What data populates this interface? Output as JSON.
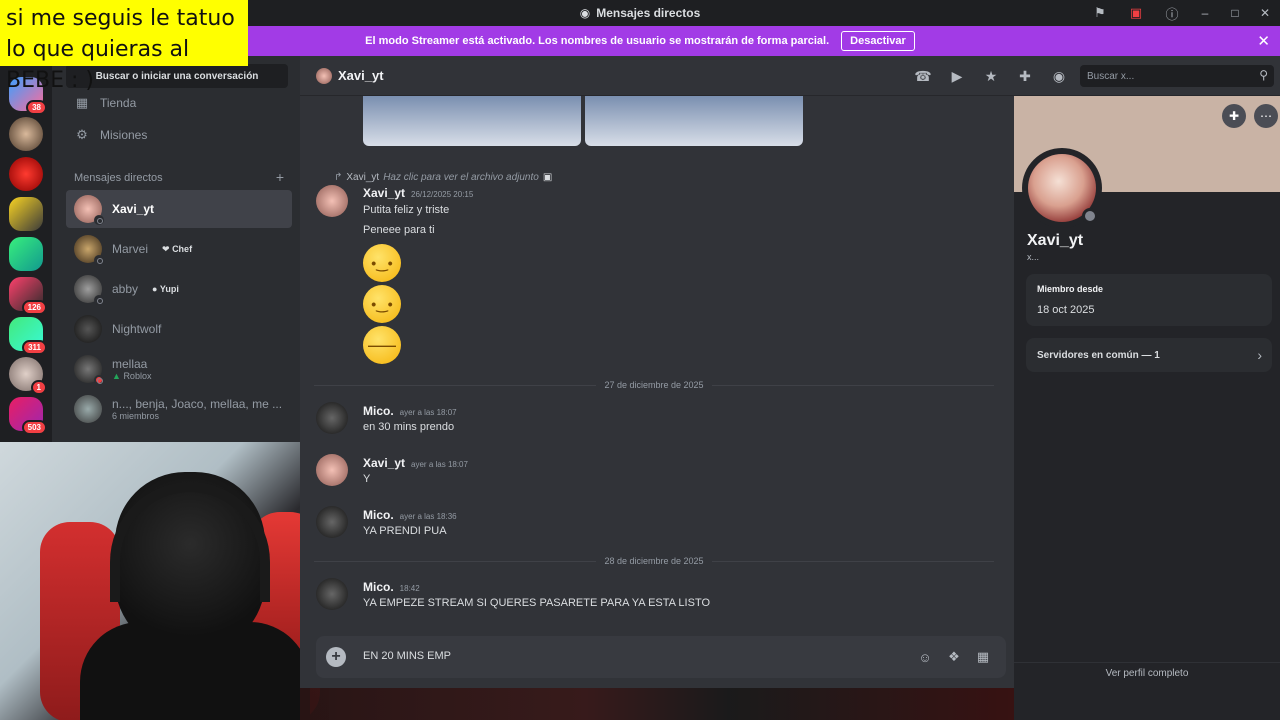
{
  "overlay": {
    "caption": "si me seguis le tatuo lo que quieras al BEBE : )"
  },
  "titlebar": {
    "title": "Mensajes directos",
    "icons": [
      "flag-icon",
      "screen-share-icon",
      "help-icon"
    ]
  },
  "banner": {
    "text": "El modo Streamer está activado. Los nombres de usuario se mostrarán de forma parcial.",
    "button": "Desactivar",
    "color": "#a23be6"
  },
  "servers": [
    {
      "badge": "38"
    },
    {
      "badge": ""
    },
    {
      "badge": ""
    },
    {
      "badge": ""
    },
    {
      "badge": ""
    },
    {
      "badge": "126"
    },
    {
      "badge": "311"
    },
    {
      "badge": "1"
    },
    {
      "badge": "503"
    }
  ],
  "sidebar": {
    "search": "Buscar o iniciar una conversación",
    "nav": [
      {
        "label": "Tienda",
        "icon": "store-icon"
      },
      {
        "label": "Misiones",
        "icon": "quests-icon"
      }
    ],
    "dm_header": "Mensajes directos",
    "dms": [
      {
        "name": "Xavi_yt",
        "sub": "",
        "tag": "",
        "active": true
      },
      {
        "name": "Marvei",
        "sub": "",
        "tag": "Chef",
        "active": false
      },
      {
        "name": "abby",
        "sub": "",
        "tag": "Yupi",
        "active": false
      },
      {
        "name": "Nightwolf",
        "sub": "",
        "tag": "",
        "active": false
      },
      {
        "name": "mellaa",
        "sub": "Roblox",
        "tag": "",
        "active": false
      },
      {
        "name": "n..., benja, Joaco, mellaa, me ...",
        "sub": "6 miembros",
        "tag": "",
        "active": false
      }
    ]
  },
  "chat": {
    "recipient": "Xavi_yt",
    "search_placeholder": "Buscar x...",
    "reply": {
      "author": "Xavi_yt",
      "text": "Haz clic para ver el archivo adjunto"
    },
    "messages": [
      {
        "author": "Xavi_yt",
        "time": "26/12/2025 20:15",
        "lines": [
          "Putita feliz y triste",
          "Peneee para ti"
        ]
      },
      {
        "author": "Mico.",
        "time": "ayer a las 18:07",
        "lines": [
          "en 30 mins prendo"
        ]
      },
      {
        "author": "Xavi_yt",
        "time": "ayer a las 18:07",
        "lines": [
          "Y"
        ]
      },
      {
        "author": "Mico.",
        "time": "ayer a las 18:36",
        "lines": [
          "YA PRENDI PUA"
        ]
      },
      {
        "author": "Mico.",
        "time": "18:42",
        "lines": [
          "YA EMPEZE STREAM SI QUERES PASARETE PARA YA ESTA LISTO"
        ]
      }
    ],
    "dividers": [
      "27 de diciembre de 2025",
      "28 de diciembre de 2025"
    ],
    "composer_value": "EN 20 MINS EMP"
  },
  "profile": {
    "name": "Xavi_yt",
    "sub": "x...",
    "member_since_label": "Miembro desde",
    "member_since": "18 oct 2025",
    "mutual_servers": "Servidores en común — 1",
    "full_profile": "Ver perfil completo"
  }
}
